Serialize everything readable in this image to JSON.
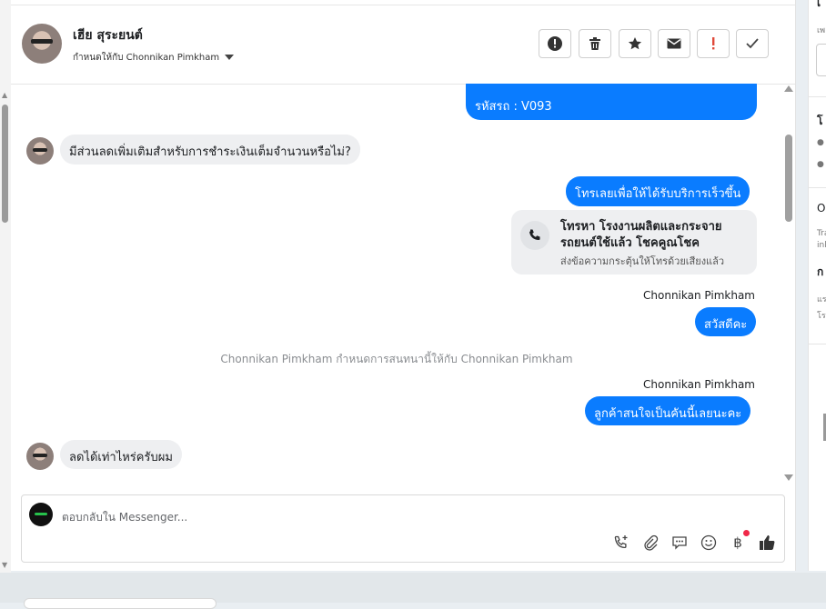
{
  "header": {
    "contact_name": "เฮีย สุระยนต์",
    "assigned_text": "กำหนดให้กับ Chonnikan Pimkham"
  },
  "toolbar": {
    "buttons": [
      {
        "name": "alert-button",
        "icon": "exclamation-circle-icon"
      },
      {
        "name": "delete-button",
        "icon": "trash-icon"
      },
      {
        "name": "star-button",
        "icon": "star-icon"
      },
      {
        "name": "mark-unread-button",
        "icon": "envelope-icon"
      },
      {
        "name": "spam-button",
        "icon": "exclamation-icon"
      },
      {
        "name": "done-button",
        "icon": "check-icon"
      }
    ]
  },
  "messages": {
    "m1": "รหัสรถ : V093",
    "m2": "มีส่วนลดเพิ่มเติมสำหรับการชำระเงินเต็มจำนวนหรือไม่?",
    "m3": "โทรเลยเพื่อให้ได้รับบริการเร็วขึ้น",
    "call_title": "โทรหา โรงงานผลิตและกระจายรถยนต์ใช้แล้ว โชคคูณโชค",
    "call_sub": "ส่งข้อความกระตุ้นให้โทรด้วยเสียงแล้ว",
    "sender1": "Chonnikan Pimkham",
    "m4": "สวัสดีคะ",
    "system1": "Chonnikan Pimkham กำหนดการสนทนานี้ให้กับ Chonnikan Pimkham",
    "sender2": "Chonnikan Pimkham",
    "m5": "ลูกค้าสนใจเป็นคันนี้เลยนะคะ",
    "m6": "ลดได้เท่าไหร่ครับผม"
  },
  "composer": {
    "placeholder": "ตอบกลับใน Messenger...",
    "tools": [
      "phone-plus-icon",
      "paperclip-icon",
      "saved-reply-icon",
      "emoji-icon",
      "baht-icon",
      "thumbs-up-icon"
    ],
    "baht_symbol": "฿"
  },
  "right_panel": {
    "t1": "เ",
    "t2": "เพ",
    "t3": "โ",
    "t4": "O",
    "t5": "Tra",
    "t6": "inl",
    "t7": "ก",
    "t8": "แร",
    "t9": "โร"
  },
  "colors": {
    "accent": "#0a7cff",
    "incoming": "#eeeff1",
    "alert_red": "#e04a3a"
  }
}
